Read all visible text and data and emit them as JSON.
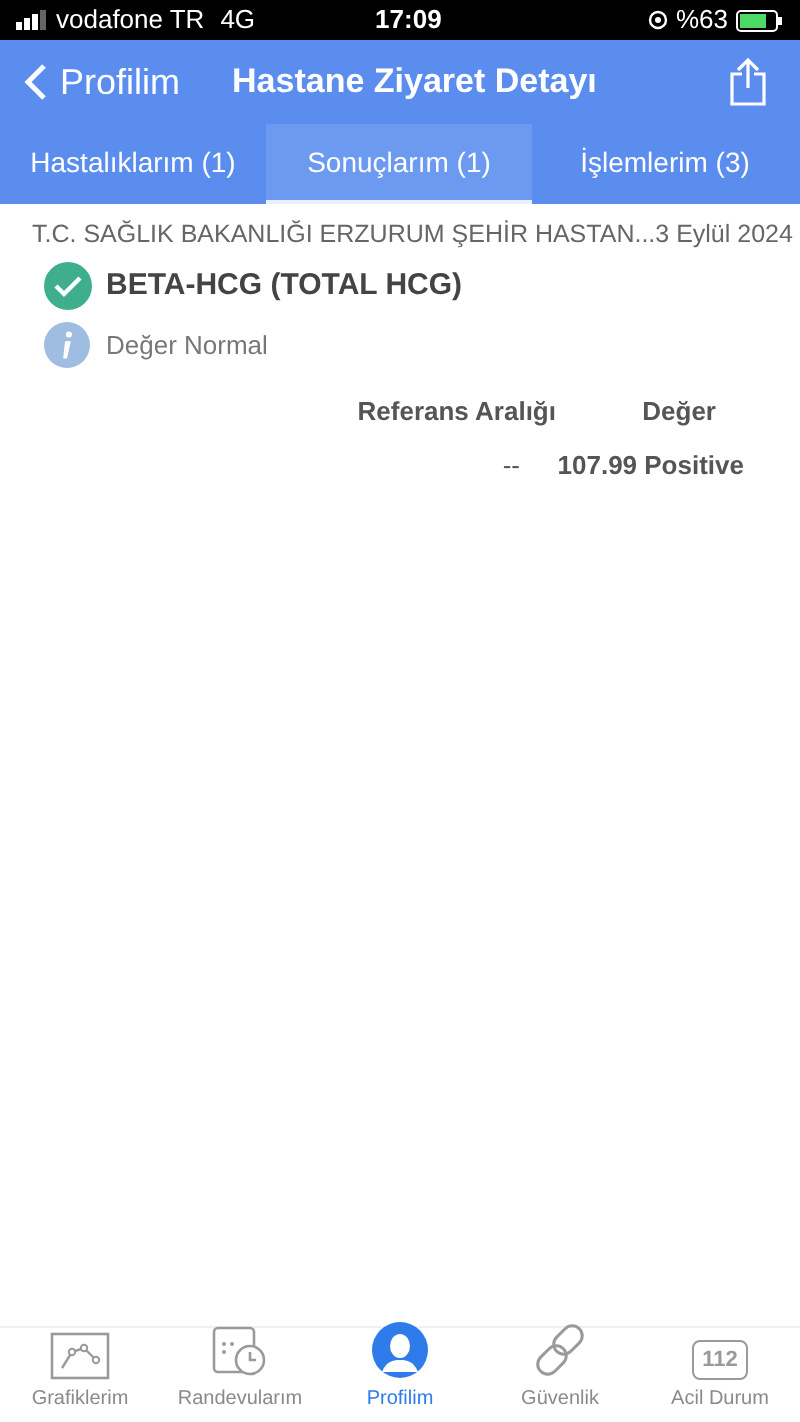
{
  "status_bar": {
    "carrier": "vodafone TR",
    "network": "4G",
    "time": "17:09",
    "battery": "%63"
  },
  "nav": {
    "back": "Profilim",
    "title": "Hastane Ziyaret Detayı"
  },
  "tabs": [
    {
      "label": "Hastalıklarım (1)",
      "selected": false
    },
    {
      "label": "Sonuçlarım (1)",
      "selected": true
    },
    {
      "label": "İşlemlerim (3)",
      "selected": false
    }
  ],
  "visit": {
    "hospital": "T.C. SAĞLIK BAKANLIĞI ERZURUM ŞEHİR HASTAN...",
    "date": "3 Eylül 2024"
  },
  "result": {
    "test": "BETA-HCG (TOTAL HCG)",
    "status": "Değer Normal",
    "columns": [
      "Referans Aralığı",
      "Değer"
    ],
    "row": [
      "--",
      "107.99 Positive"
    ]
  },
  "bottom_tabs": [
    {
      "kind": "chart",
      "label": "Grafiklerim",
      "selected": false
    },
    {
      "kind": "calendar",
      "label": "Randevularım",
      "selected": false
    },
    {
      "kind": "profile",
      "label": "Profilim",
      "selected": true
    },
    {
      "kind": "link",
      "label": "Güvenlik",
      "selected": false
    },
    {
      "kind": "emergency",
      "label": "Acil Durum",
      "badge": "112",
      "selected": false
    }
  ]
}
